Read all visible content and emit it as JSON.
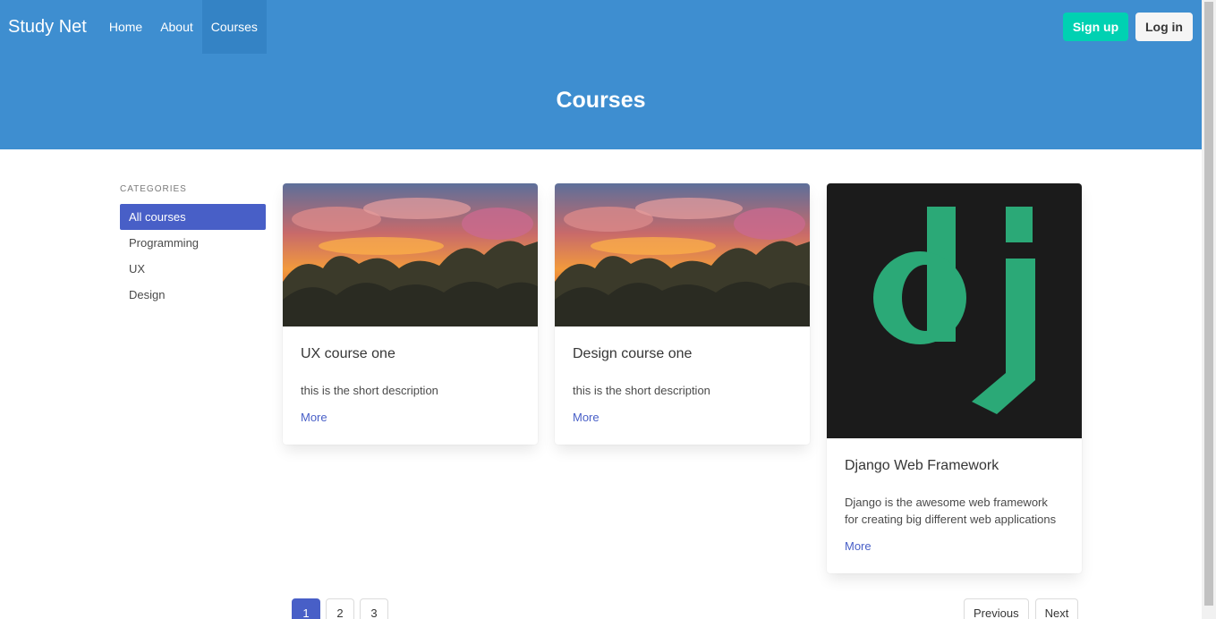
{
  "navbar": {
    "brand": "Study Net",
    "items": [
      {
        "label": "Home"
      },
      {
        "label": "About"
      },
      {
        "label": "Courses",
        "active": true
      }
    ],
    "signup_label": "Sign up",
    "login_label": "Log in"
  },
  "hero": {
    "title": "Courses"
  },
  "sidebar": {
    "label": "CATEGORIES",
    "items": [
      {
        "label": "All courses",
        "active": true
      },
      {
        "label": "Programming"
      },
      {
        "label": "UX"
      },
      {
        "label": "Design"
      }
    ]
  },
  "courses": [
    {
      "title": "UX course one",
      "description": "this is the short description",
      "link": "More",
      "image": "sunset-forest-image"
    },
    {
      "title": "Design course one",
      "description": "this is the short description",
      "link": "More",
      "image": "sunset-forest-image"
    },
    {
      "title": "Django Web Framework",
      "description": "Django is the awesome web framework for creating big different web applications",
      "link": "More",
      "image": "django-logo-image"
    }
  ],
  "pagination": {
    "pages": [
      "1",
      "2",
      "3"
    ],
    "current": "1",
    "previous_label": "Previous",
    "next_label": "Next"
  },
  "colors": {
    "primary": "#3e8ed0",
    "link": "#485fc7",
    "success": "#00d1b2",
    "django_green": "#2ba977",
    "django_bg": "#1b1b1b"
  }
}
